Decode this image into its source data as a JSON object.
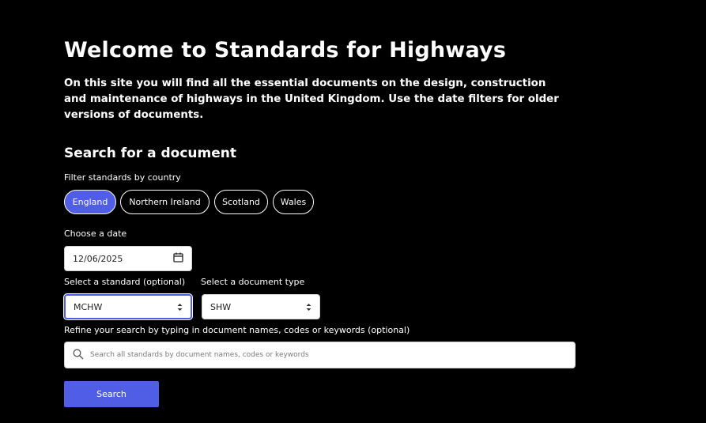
{
  "header": {
    "title": "Welcome to Standards for Highways",
    "intro": "On this site you will find all the essential documents on the design, construction and maintenance of highways in the United Kingdom. Use the date filters for older versions of documents."
  },
  "search": {
    "section_title": "Search for a document",
    "country_label": "Filter standards by country",
    "countries": [
      "England",
      "Northern Ireland",
      "Scotland",
      "Wales"
    ],
    "selected_country": "England",
    "date_label": "Choose a date",
    "date_value": "12/06/2025",
    "standard_label": "Select a standard (optional)",
    "standard_value": "MCHW",
    "doc_type_label": "Select a document type",
    "doc_type_value": "SHW",
    "refine_label": "Refine your search by typing in document names, codes or keywords (optional)",
    "placeholder": "Search all standards by document names, codes or keywords",
    "button_label": "Search"
  },
  "colors": {
    "background": "#000000",
    "accent": "#4f5ee5",
    "text": "#ffffff"
  },
  "icons": {
    "date": "calendar-icon",
    "search": "search-icon",
    "select": "updown-chevron-icon"
  }
}
